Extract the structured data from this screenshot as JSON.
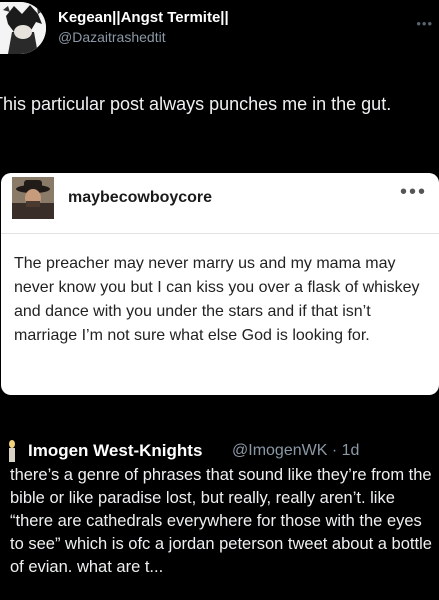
{
  "post": {
    "display_name": "Kegean||Angst Termite||",
    "handle": "@Dazaitrashedtit",
    "text": "This particular post always punches me in the gut."
  },
  "embedded_post": {
    "username": "maybecowboycore",
    "more_label": "•••",
    "body": "The preacher may never marry us and my mama may never know you but I can kiss you over a flask of whiskey and dance with you under the stars and if that isn’t marriage I’m not sure what else God is looking for."
  },
  "quoted_reply": {
    "display_name": "Imogen West-Knights",
    "handle_time": "@ImogenWK · 1d",
    "body": "there’s a genre of phrases that sound like they’re from the bible or like paradise lost, but really, really aren’t. like “there are cathedrals everywhere for those with the eyes to see” which is ofc a jordan peterson tweet about a bottle of evian. what are t..."
  },
  "icons": {
    "profile_avatar": "anime-avatar-icon",
    "card_avatar": "cowboy-avatar-icon",
    "more": "more-dots-icon",
    "quote_avatar": "candle-avatar-icon"
  },
  "colors": {
    "background": "#000000",
    "secondary_text": "#8b98a5",
    "card_background": "#ffffff"
  }
}
